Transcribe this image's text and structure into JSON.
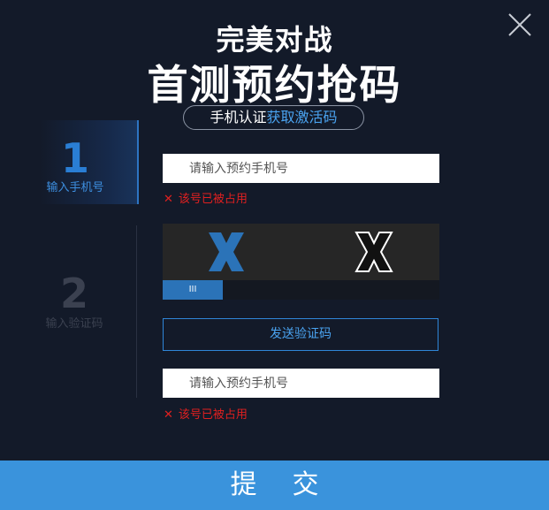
{
  "header": {
    "title_line1": "完美对战",
    "title_line2": "首测预约抢码",
    "subtitle_white": "手机认证",
    "subtitle_blue": "获取激活码"
  },
  "steps": [
    {
      "number": "1",
      "label": "输入手机号",
      "active": true
    },
    {
      "number": "2",
      "label": "输入验证码",
      "active": false
    }
  ],
  "phone_form": {
    "phone_placeholder": "请输入预约手机号",
    "error_text": "该号已被占用"
  },
  "captcha": {
    "handle_label": "III"
  },
  "code_form": {
    "send_code_label": "发送验证码",
    "code_placeholder": "请输入预约手机号",
    "error_text": "该号已被占用"
  },
  "footer": {
    "submit_label": "提交"
  },
  "colors": {
    "background": "#131a29",
    "accent_blue": "#3a93dc",
    "error_red": "#e02020"
  }
}
